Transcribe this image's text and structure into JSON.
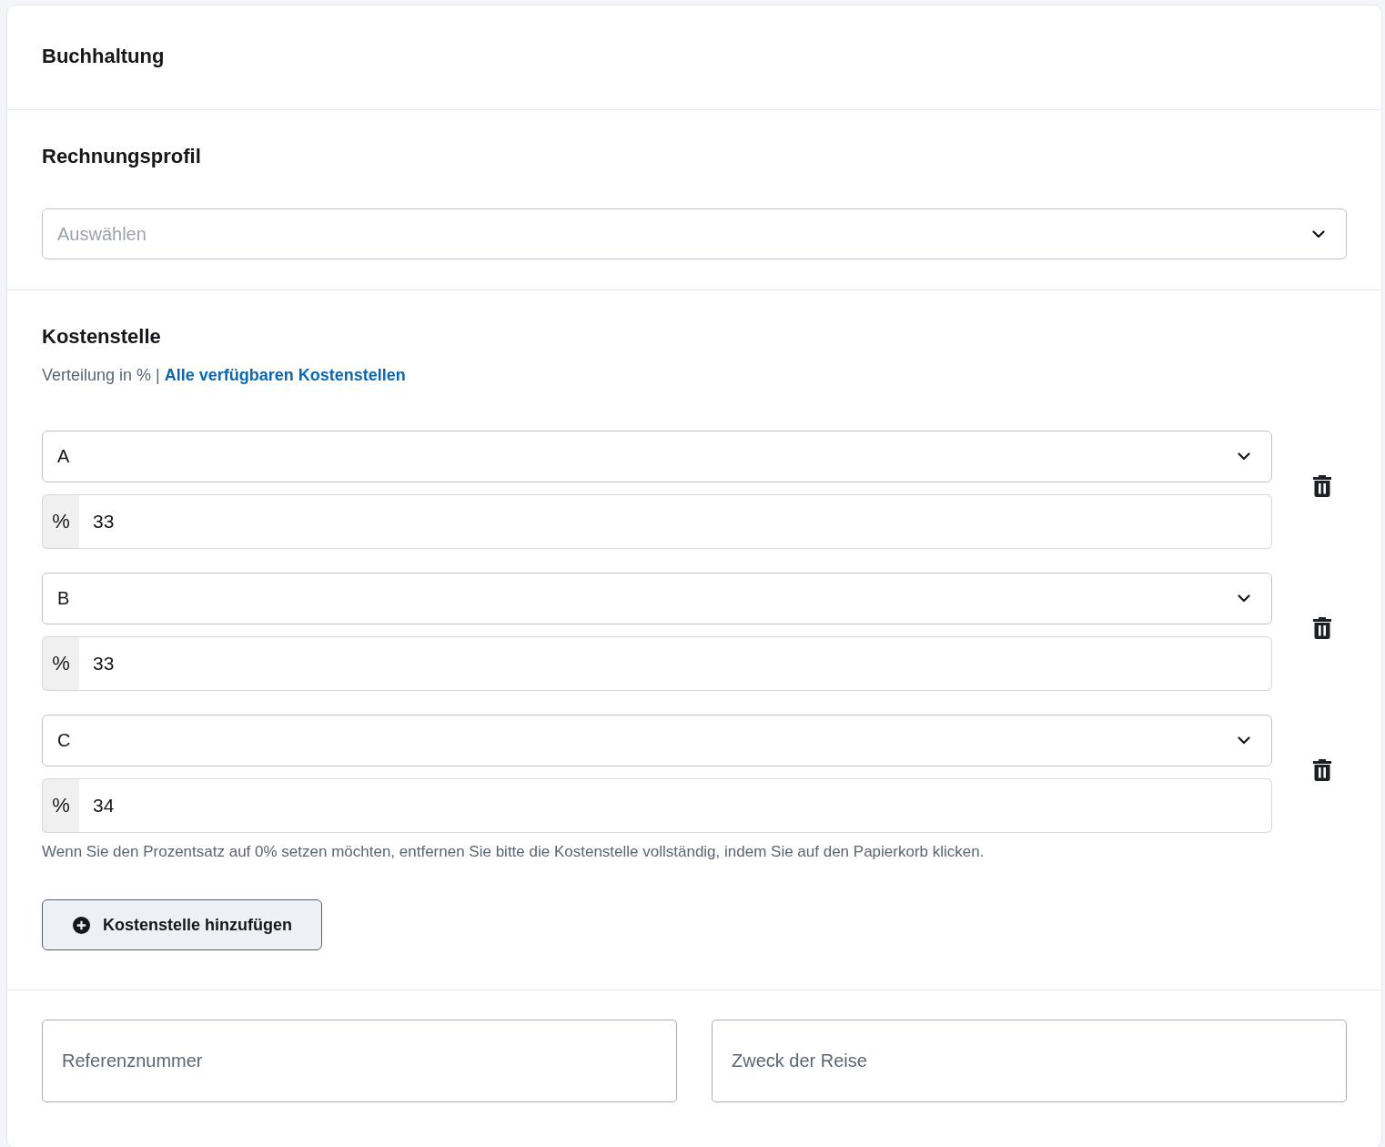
{
  "header": {
    "title": "Buchhaltung"
  },
  "billing_profile": {
    "title": "Rechnungsprofil",
    "select": {
      "placeholder": "Auswählen"
    }
  },
  "cost_centers": {
    "title": "Kostenstelle",
    "subtitle": "Verteilung in % |",
    "link": "Alle verfügbaren Kostenstellen",
    "rows": [
      {
        "value": "A",
        "unit": "%",
        "percent": "33"
      },
      {
        "value": "B",
        "unit": "%",
        "percent": "33"
      },
      {
        "value": "C",
        "unit": "%",
        "percent": "34"
      }
    ],
    "hint": "Wenn Sie den Prozentsatz auf 0% setzen möchten, entfernen Sie bitte die Kostenstelle vollständig, indem Sie auf den Papierkorb klicken.",
    "add_button": "Kostenstelle hinzufügen"
  },
  "fields": [
    {
      "placeholder": "Referenznummer"
    },
    {
      "placeholder": "Zweck der Reise"
    }
  ]
}
